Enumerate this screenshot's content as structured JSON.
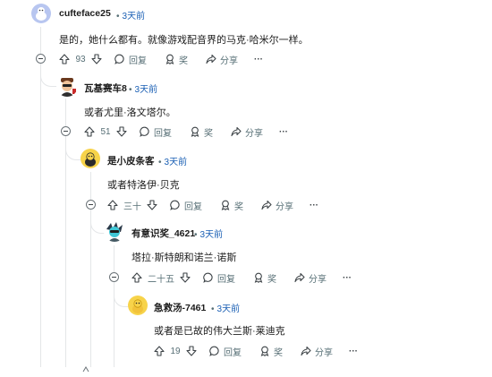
{
  "comments": [
    {
      "username": "cufteface25",
      "separator": "•",
      "time": "3天前",
      "body": "是的，她什么都有。就像游戏配音界的马克·哈米尔一样。",
      "score": "93",
      "reply_label": "回复",
      "award_label": "奖",
      "share_label": "分享",
      "more_label": "···"
    },
    {
      "username": "瓦基赛车8",
      "separator": "•",
      "time": "3天前",
      "body": "或者尤里·洛文塔尔。",
      "score": "51",
      "reply_label": "回复",
      "award_label": "奖",
      "share_label": "分享",
      "more_label": "···"
    },
    {
      "username": "是小皮条客",
      "separator": "•",
      "time": "3天前",
      "body": "或者特洛伊·贝克",
      "score": "三十",
      "reply_label": "回复",
      "award_label": "奖",
      "share_label": "分享",
      "more_label": "···"
    },
    {
      "username": "有意识奖_4621",
      "separator": "•",
      "time": "3天前",
      "body": "塔拉·斯特朗和诺兰·诺斯",
      "score": "二十五",
      "reply_label": "回复",
      "award_label": "奖",
      "share_label": "分享",
      "more_label": "···"
    },
    {
      "username": "急救汤-7461",
      "separator": "•",
      "time": "3天前",
      "body": "或者是已故的伟大兰斯·莱迪克",
      "score": "19",
      "reply_label": "回复",
      "award_label": "奖",
      "share_label": "分享",
      "more_label": "···"
    }
  ],
  "colors": {
    "link_time": "#1a5fb4",
    "meta_gray": "#576f76",
    "thread_line": "#e4e6e8"
  }
}
